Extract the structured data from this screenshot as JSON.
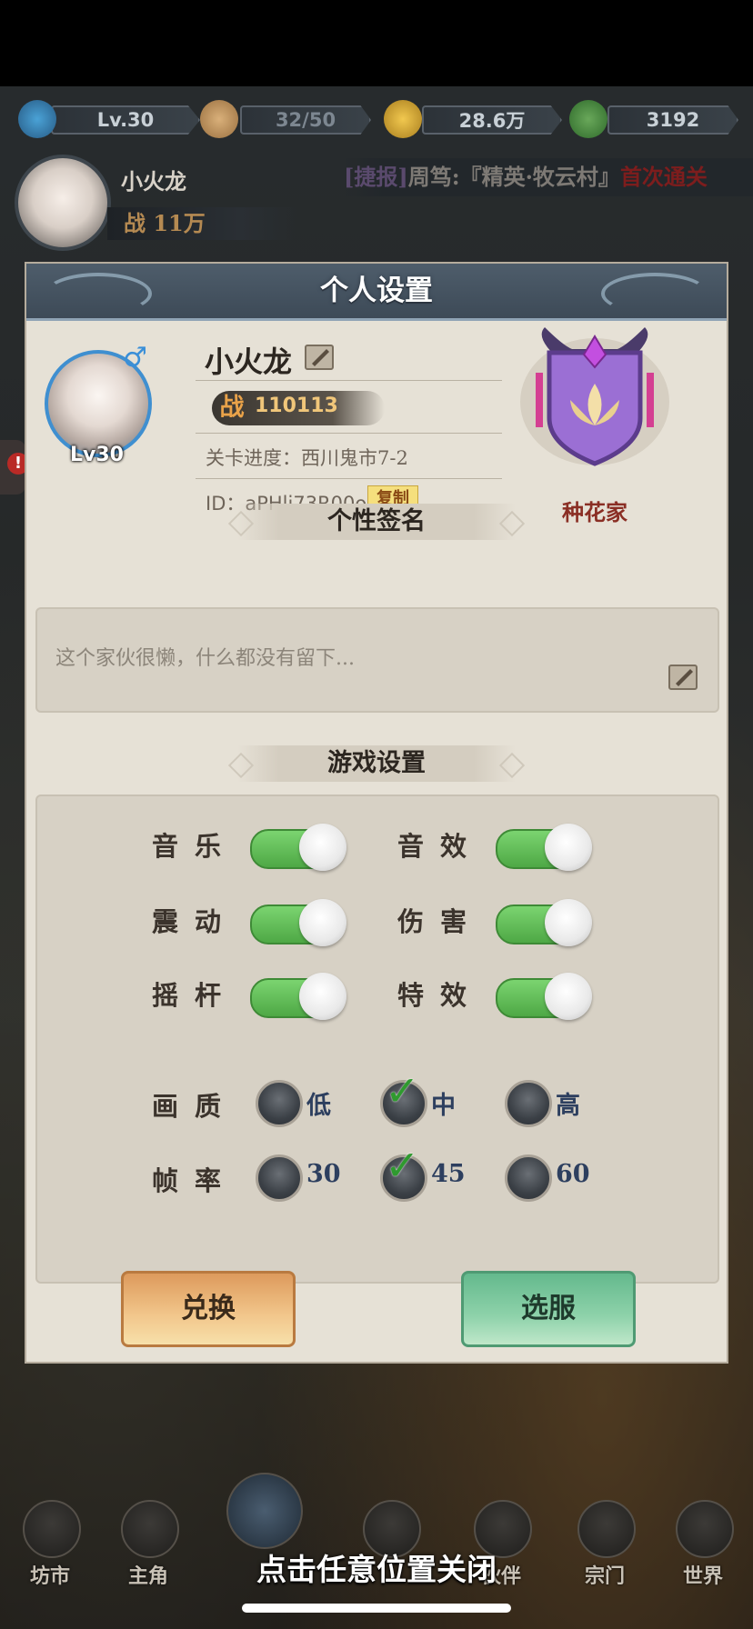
{
  "resources": {
    "level": "Lv.30",
    "stamina": "32/50",
    "coins": "28.6万",
    "leaves": "3192"
  },
  "top_player": {
    "name": "小火龙",
    "power": "战 11万"
  },
  "ticker": {
    "tag": "[捷报]",
    "text": "周笃:『精英·牧云村』",
    "tail": "首次通关"
  },
  "panel": {
    "title": "个人设置",
    "player": {
      "name": "小火龙",
      "gender_symbol": "♂",
      "level": "Lv30",
      "power_label": "战",
      "power": "110113",
      "stage": "关卡进度：西川鬼市7-2",
      "id": "ID：aPHlj73R00o",
      "copy_label": "复制"
    },
    "title_badge": {
      "label": "种花家"
    },
    "signature": {
      "section_title": "个性签名",
      "text": "这个家伙很懒，什么都没有留下..."
    },
    "game_settings": {
      "section_title": "游戏设置",
      "toggles": [
        {
          "label": "音乐",
          "on": true
        },
        {
          "label": "音效",
          "on": true
        },
        {
          "label": "震动",
          "on": true
        },
        {
          "label": "伤害",
          "on": true
        },
        {
          "label": "摇杆",
          "on": true
        },
        {
          "label": "特效",
          "on": true
        }
      ],
      "quality": {
        "label": "画质",
        "options": [
          "低",
          "中",
          "高"
        ],
        "selected": "中"
      },
      "framerate": {
        "label": "帧率",
        "options": [
          "30",
          "45",
          "60"
        ],
        "selected": "45"
      }
    },
    "buttons": {
      "exchange": "兑换",
      "select_server": "选服"
    }
  },
  "bottom_nav": [
    "坊市",
    "主角",
    "",
    "",
    "伙伴",
    "宗门",
    "世界"
  ],
  "close_hint": "点击任意位置关闭"
}
